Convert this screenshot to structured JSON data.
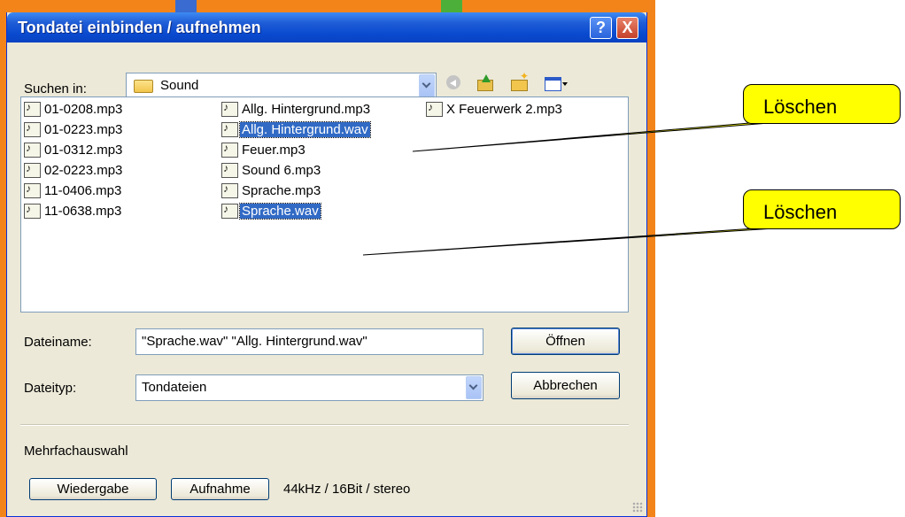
{
  "dialog": {
    "title": "Tondatei einbinden / aufnehmen",
    "help_symbol": "?",
    "close_symbol": "X",
    "look_in_label": "Suchen in:",
    "look_in_value": "Sound",
    "toolbar_icons": [
      "back-icon",
      "up-folder-icon",
      "new-folder-icon",
      "view-menu-icon"
    ],
    "files": [
      {
        "name": "01-0208.mp3",
        "selected": false
      },
      {
        "name": "01-0223.mp3",
        "selected": false
      },
      {
        "name": "01-0312.mp3",
        "selected": false
      },
      {
        "name": "02-0223.mp3",
        "selected": false
      },
      {
        "name": "11-0406.mp3",
        "selected": false
      },
      {
        "name": "11-0638.mp3",
        "selected": false
      },
      {
        "name": "Allg. Hintergrund.mp3",
        "selected": false
      },
      {
        "name": "Allg. Hintergrund.wav",
        "selected": true
      },
      {
        "name": "Feuer.mp3",
        "selected": false
      },
      {
        "name": "Sound 6.mp3",
        "selected": false
      },
      {
        "name": "Sprache.mp3",
        "selected": false
      },
      {
        "name": "Sprache.wav",
        "selected": true
      },
      {
        "name": "X Feuerwerk 2.mp3",
        "selected": false
      }
    ],
    "filename_label": "Dateiname:",
    "filename_value": "\"Sprache.wav\" \"Allg. Hintergrund.wav\"",
    "filetype_label": "Dateityp:",
    "filetype_value": "Tondateien",
    "open_button": "Öffnen",
    "cancel_button": "Abbrechen",
    "multi_select_label": "Mehrfachauswahl",
    "play_button": "Wiedergabe",
    "record_button": "Aufnahme",
    "audio_format": "44kHz / 16Bit / stereo"
  },
  "callouts": [
    {
      "text": "Löschen"
    },
    {
      "text": "Löschen"
    }
  ],
  "colors": {
    "titlebar": "#0a4bd0",
    "selection": "#316ac5",
    "callout": "#ffff00",
    "dialog_bg": "#ece9d8"
  }
}
